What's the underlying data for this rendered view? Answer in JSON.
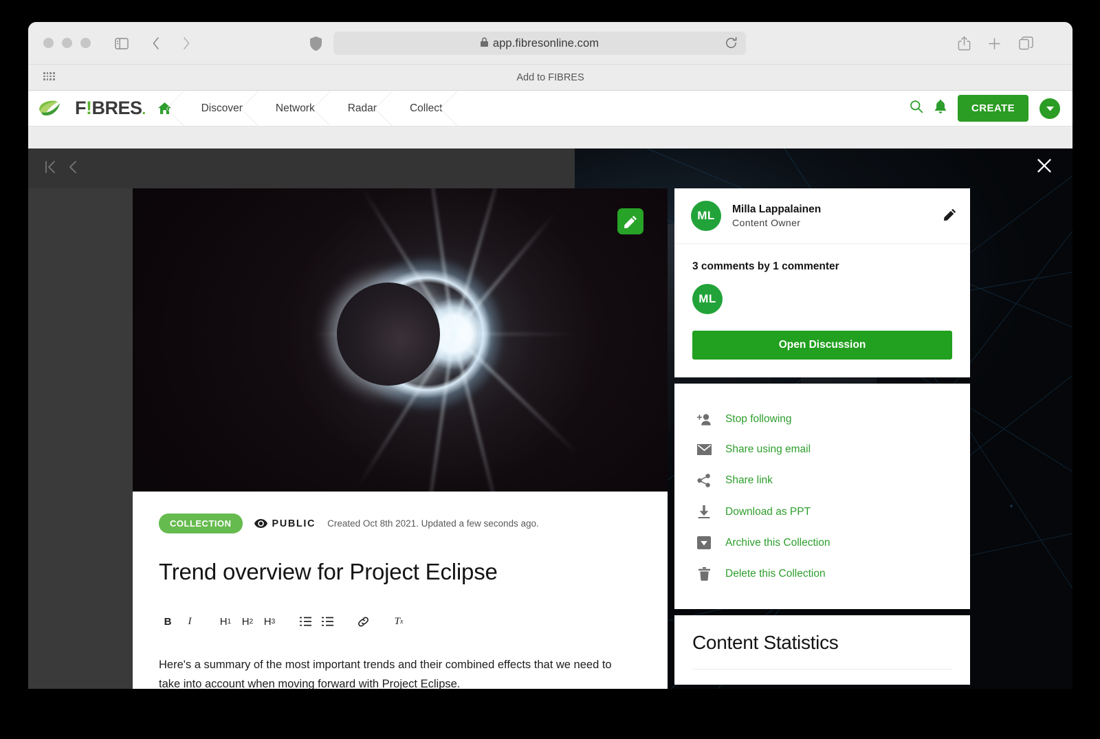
{
  "browser": {
    "url": "app.fibresonline.com",
    "lock_icon": "lock-icon",
    "reload_icon": "reload-icon",
    "bookmark_label": "Add to FIBRES"
  },
  "app_nav": {
    "logo_text_1": "F",
    "logo_bang": "!",
    "logo_text_2": "BRES",
    "logo_dot": ".",
    "items": [
      {
        "label": "",
        "name": "home"
      },
      {
        "label": "Discover",
        "name": "discover"
      },
      {
        "label": "Network",
        "name": "network"
      },
      {
        "label": "Radar",
        "name": "radar"
      },
      {
        "label": "Collect",
        "name": "collect"
      }
    ],
    "create_label": "CREATE",
    "accent_color": "#2b9c24"
  },
  "modal": {
    "first_label": "first",
    "prev_label": "previous",
    "close_label": "close"
  },
  "content": {
    "badge": "COLLECTION",
    "visibility": "PUBLIC",
    "timestamp": "Created Oct 8th 2021. Updated a few seconds ago.",
    "title": "Trend overview for Project Eclipse",
    "paragraph": "Here's a summary of the most important trends and their combined effects that we need to take into account when moving forward with Project Eclipse.",
    "toolbar": {
      "bold": "B",
      "italic": "I",
      "h1": "H",
      "h1_sub": "1",
      "h2": "H",
      "h2_sub": "2",
      "h3": "H",
      "h3_sub": "3",
      "ordered_list": "ordered-list-icon",
      "bullet_list": "bullet-list-icon",
      "link": "link-icon",
      "clear_format": "T",
      "clear_format_sub": "x"
    }
  },
  "sidebar": {
    "owner": {
      "initials": "ML",
      "name": "Milla Lappalainen",
      "role": "Content Owner"
    },
    "comments": {
      "count_text": "3 comments by 1 commenter",
      "commenter_initials": "ML",
      "open_button": "Open Discussion"
    },
    "actions": [
      {
        "label": "Stop following",
        "icon": "follow-user-icon"
      },
      {
        "label": "Share using email",
        "icon": "email-icon"
      },
      {
        "label": "Share link",
        "icon": "share-icon"
      },
      {
        "label": "Download as PPT",
        "icon": "download-icon"
      },
      {
        "label": "Archive this Collection",
        "icon": "archive-icon"
      },
      {
        "label": "Delete this Collection",
        "icon": "trash-icon"
      }
    ],
    "stats": {
      "title": "Content Statistics"
    }
  }
}
